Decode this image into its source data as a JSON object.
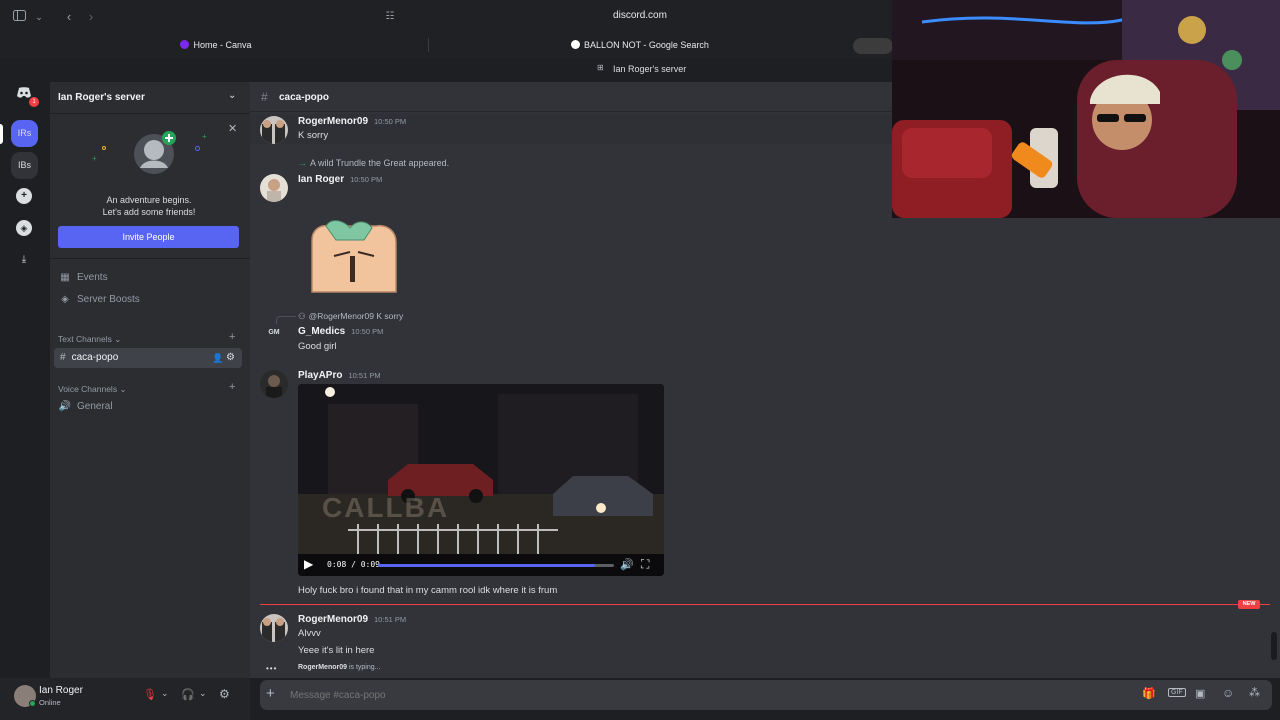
{
  "browser": {
    "url": "discord.com",
    "tabs": [
      {
        "label": "Home - Canva",
        "color": "#7d2ae8"
      },
      {
        "label": "BALLON NOT - Google Search",
        "color": "#ffffff"
      }
    ]
  },
  "window": {
    "title": "Ian Roger's server"
  },
  "rail": {
    "notification_count": "1",
    "servers": [
      {
        "label": "IRs",
        "color": "#5865f2"
      },
      {
        "label": "IBs",
        "color": "#313338"
      }
    ],
    "icons": [
      "discord-icon",
      "add-server-icon",
      "explore-icon",
      "download-icon"
    ]
  },
  "sidebar": {
    "server_name": "Ian Roger's server",
    "promo": {
      "line1": "An adventure begins.",
      "line2": "Let's add some friends!"
    },
    "invite_label": "Invite People",
    "items": [
      {
        "label": "Events",
        "icon": "calendar-icon"
      },
      {
        "label": "Server Boosts",
        "icon": "boost-icon"
      }
    ],
    "text_category": "Text Channels",
    "active_channel": "caca-popo",
    "voice_category": "Voice Channels",
    "voice_channel": "General"
  },
  "user": {
    "name": "Ian Roger",
    "status": "Online"
  },
  "chat": {
    "channel_name": "caca-popo",
    "messages": [
      {
        "author": "RogerMenor09",
        "time": "10:50 PM",
        "text": "K sorry"
      },
      {
        "system": "A wild Trundle the Great appeared."
      },
      {
        "author": "Ian Roger",
        "time": "10:50 PM",
        "text": ""
      },
      {
        "reply": "@RogerMenor09 K sorry",
        "author": "G_Medics",
        "time": "10:50 PM",
        "text": "Good girl",
        "avatar_text": "GM"
      },
      {
        "author": "PlayAPro",
        "time": "10:51 PM",
        "text": "Holy fuck bro i found that in my camm rool idk where it is frum"
      },
      {
        "author": "RogerMenor09",
        "time": "10:51 PM",
        "text": "Alvvv",
        "text2": "Yeee it's lit in here"
      }
    ],
    "video": {
      "current": "0:08",
      "duration": "0:09",
      "time_display": "0:08 / 0:09",
      "progress": 0.92,
      "watermark": "CALLBA"
    },
    "new_badge": "NEW",
    "typing_user": "RogerMenor09",
    "typing_suffix": "is typing...",
    "composer_placeholder": "Message #caca-popo"
  }
}
